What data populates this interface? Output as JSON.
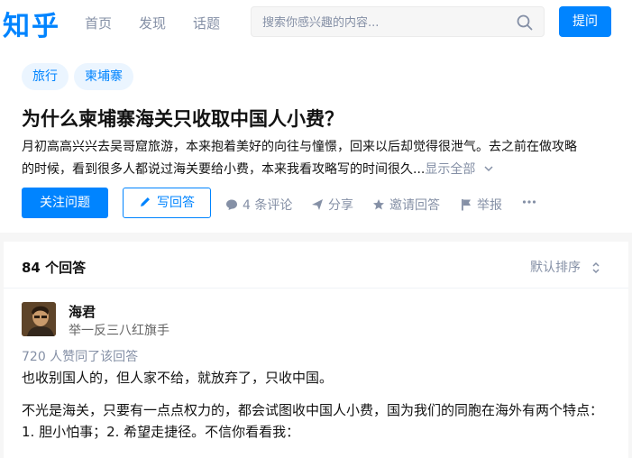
{
  "header": {
    "logo": "知乎",
    "nav": [
      "首页",
      "发现",
      "话题"
    ],
    "search_placeholder": "搜索你感兴趣的内容...",
    "ask_label": "提问"
  },
  "question": {
    "tags": [
      "旅行",
      "柬埔寨"
    ],
    "title": "为什么柬埔寨海关只收取中国人小费？",
    "detail_line1": "月初高高兴兴去吴哥窟旅游，本来抱着美好的向往与憧憬，回来以后却觉得很泄气。去之前在做攻略",
    "detail_line2": "的时候，看到很多人都说过海关要给小费，本来我看攻略写的时间很久...",
    "show_all": "显示全部",
    "follow_label": "关注问题",
    "write_label": "写回答",
    "comments_label": "4 条评论",
    "share_label": "分享",
    "invite_label": "邀请回答",
    "report_label": "举报"
  },
  "answers": {
    "count_label": "84 个回答",
    "sort_label": "默认排序",
    "first": {
      "author": "海君",
      "bio": "举一反三八红旗手",
      "votes": "720 人赞同了该回答",
      "p1": "也收别国人的，但人家不给，就放弃了，只收中国。",
      "p2": "不光是海关，只要有一点点权力的，都会试图收中国人小费，国为我们的同胞在海外有两个特点：",
      "p3": "1. 胆小怕事；2. 希望走捷径。不信你看看我："
    }
  },
  "colors": {
    "brand": "#0084ff",
    "muted": "#8590a6",
    "tag_bg": "#ebf5ff"
  }
}
